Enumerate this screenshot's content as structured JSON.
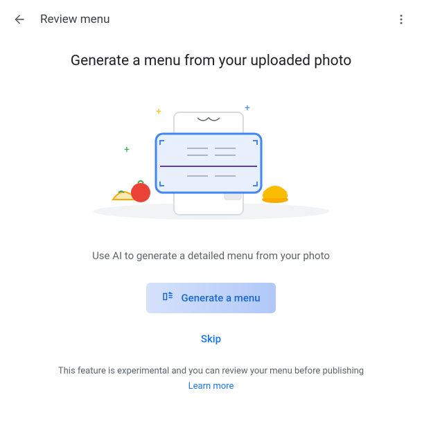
{
  "header": {
    "title": "Review menu"
  },
  "main": {
    "heading": "Generate a menu from your uploaded photo",
    "subtext": "Use AI to generate a detailed menu from your photo",
    "generate_label": "Generate a menu",
    "skip_label": "Skip",
    "disclaimer": "This feature is experimental and you can review your menu before publishing",
    "learn_more_label": "Learn more"
  },
  "colors": {
    "accent": "#1a73e8",
    "button_bg_start": "#d5e2fb",
    "button_bg_end": "#b1c8f8"
  }
}
